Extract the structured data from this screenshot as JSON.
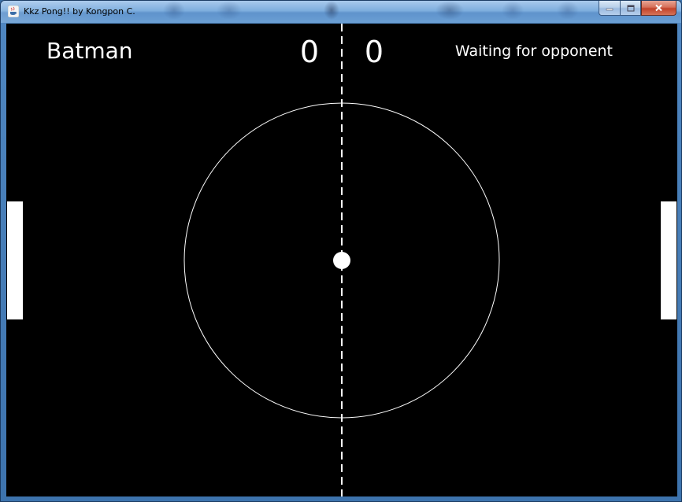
{
  "window": {
    "title": "Kkz Pong!! by Kongpon C."
  },
  "icons": {
    "app": "java-cup-icon",
    "minimize": "minimize-icon",
    "maximize": "maximize-icon",
    "close": "close-icon"
  },
  "game": {
    "player_name": "Batman",
    "score_left": "0",
    "score_right": "0",
    "status": "Waiting for opponent",
    "colors": {
      "background": "#000000",
      "foreground": "#ffffff"
    }
  }
}
